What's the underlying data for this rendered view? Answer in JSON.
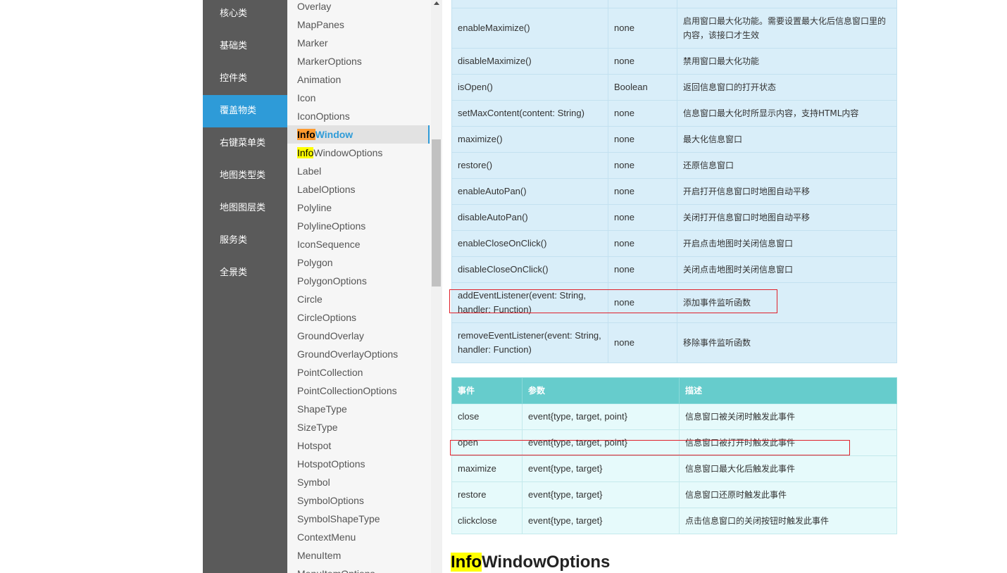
{
  "category_nav": {
    "items": [
      "核心类",
      "基础类",
      "控件类",
      "覆盖物类",
      "右键菜单类",
      "地图类型类",
      "地图图层类",
      "服务类",
      "全景类"
    ],
    "active_index": 3
  },
  "class_nav": {
    "items": [
      {
        "label": "Overlay"
      },
      {
        "label": "MapPanes"
      },
      {
        "label": "Marker"
      },
      {
        "label": "MarkerOptions"
      },
      {
        "label": "Animation"
      },
      {
        "label": "Icon"
      },
      {
        "label": "IconOptions"
      },
      {
        "hl": "Info",
        "rest": "Window",
        "active": true
      },
      {
        "hl": "Info",
        "rest": "WindowOptions"
      },
      {
        "label": "Label"
      },
      {
        "label": "LabelOptions"
      },
      {
        "label": "Polyline"
      },
      {
        "label": "PolylineOptions"
      },
      {
        "label": "IconSequence"
      },
      {
        "label": "Polygon"
      },
      {
        "label": "PolygonOptions"
      },
      {
        "label": "Circle"
      },
      {
        "label": "CircleOptions"
      },
      {
        "label": "GroundOverlay"
      },
      {
        "label": "GroundOverlayOptions"
      },
      {
        "label": "PointCollection"
      },
      {
        "label": "PointCollectionOptions"
      },
      {
        "label": "ShapeType"
      },
      {
        "label": "SizeType"
      },
      {
        "label": "Hotspot"
      },
      {
        "label": "HotspotOptions"
      },
      {
        "label": "Symbol"
      },
      {
        "label": "SymbolOptions"
      },
      {
        "label": "SymbolShapeType"
      },
      {
        "label": "ContextMenu"
      },
      {
        "label": "MenuItem"
      },
      {
        "label": "MenuItemOptions"
      }
    ]
  },
  "methods_table": {
    "rows": [
      {
        "method": "",
        "returns": "",
        "desc": ""
      },
      {
        "method": "enableMaximize()",
        "returns": "none",
        "desc": "启用窗口最大化功能。需要设置最大化后信息窗口里的内容，该接口才生效"
      },
      {
        "method": "disableMaximize()",
        "returns": "none",
        "desc": "禁用窗口最大化功能"
      },
      {
        "method": "isOpen()",
        "returns": "Boolean",
        "desc": "返回信息窗口的打开状态"
      },
      {
        "method": "setMaxContent(content: String)",
        "returns": "none",
        "desc": "信息窗口最大化时所显示内容，支持HTML内容"
      },
      {
        "method": "maximize()",
        "returns": "none",
        "desc": "最大化信息窗口"
      },
      {
        "method": "restore()",
        "returns": "none",
        "desc": "还原信息窗口"
      },
      {
        "method": "enableAutoPan()",
        "returns": "none",
        "desc": "开启打开信息窗口时地图自动平移"
      },
      {
        "method": "disableAutoPan()",
        "returns": "none",
        "desc": "关闭打开信息窗口时地图自动平移"
      },
      {
        "method": "enableCloseOnClick()",
        "returns": "none",
        "desc": "开启点击地图时关闭信息窗口"
      },
      {
        "method": "disableCloseOnClick()",
        "returns": "none",
        "desc": "关闭点击地图时关闭信息窗口"
      },
      {
        "method": "addEventListener(event: String, handler: Function)",
        "returns": "none",
        "desc": "添加事件监听函数"
      },
      {
        "method": "removeEventListener(event: String, handler: Function)",
        "returns": "none",
        "desc": "移除事件监听函数"
      }
    ]
  },
  "events_table": {
    "headers": {
      "event": "事件",
      "params": "参数",
      "desc": "描述"
    },
    "rows": [
      {
        "event": "close",
        "params": "event{type, target, point}",
        "desc": "信息窗口被关闭时触发此事件"
      },
      {
        "event": "open",
        "params": "event{type, target, point}",
        "desc": "信息窗口被打开时触发此事件"
      },
      {
        "event": "maximize",
        "params": "event{type, target}",
        "desc": "信息窗口最大化后触发此事件"
      },
      {
        "event": "restore",
        "params": "event{type, target}",
        "desc": "信息窗口还原时触发此事件"
      },
      {
        "event": "clickclose",
        "params": "event{type, target}",
        "desc": "点击信息窗口的关闭按钮时触发此事件"
      }
    ]
  },
  "section": {
    "hl": "Info",
    "rest": "WindowOptions"
  },
  "colors": {
    "category_nav_bg": "#5a5a5a",
    "category_active_bg": "#2e9bd8",
    "class_nav_bg": "#f6f6f6",
    "active_link": "#2e9bd8",
    "highlight_yellow": "#ffff00",
    "highlight_orange": "#ff9a2e",
    "methods_table_bg": "#d9eef9",
    "events_header_bg": "#66cccc",
    "events_table_bg": "#e6fafb",
    "annotation_red": "#e0202a"
  }
}
